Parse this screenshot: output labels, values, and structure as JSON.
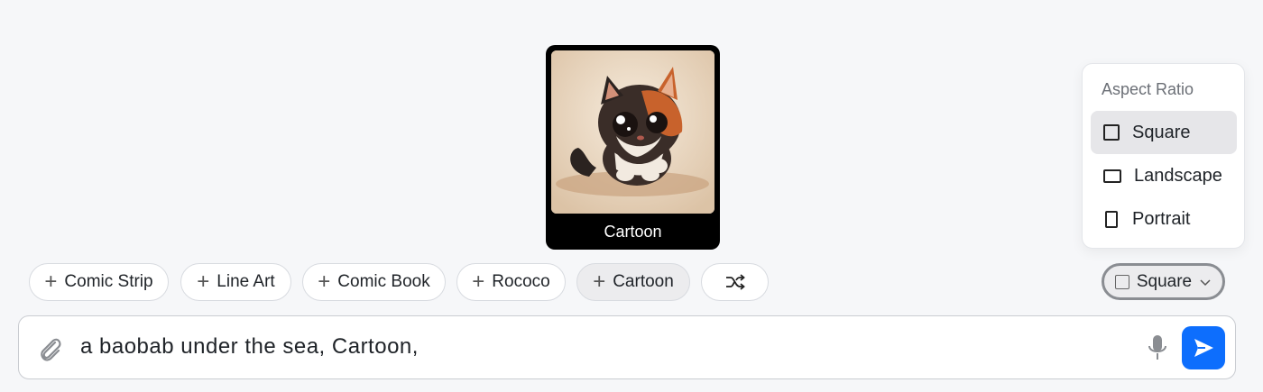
{
  "preview": {
    "label": "Cartoon",
    "image_icon": "cartoon-kitten-image"
  },
  "chips": [
    {
      "label": "Comic Strip",
      "icon": "plus-icon"
    },
    {
      "label": "Line Art",
      "icon": "plus-icon"
    },
    {
      "label": "Comic Book",
      "icon": "plus-icon"
    },
    {
      "label": "Rococo",
      "icon": "plus-icon"
    },
    {
      "label": "Cartoon",
      "icon": "plus-icon",
      "active": true
    },
    {
      "label": "",
      "icon": "shuffle-icon"
    }
  ],
  "aspect_menu": {
    "heading": "Aspect Ratio",
    "options": [
      {
        "label": "Square",
        "icon": "square-icon",
        "selected": true
      },
      {
        "label": "Landscape",
        "icon": "landscape-icon"
      },
      {
        "label": "Portrait",
        "icon": "portrait-icon"
      }
    ]
  },
  "aspect_button": {
    "label": "Square",
    "icon": "square-icon",
    "chevron": "chevron-down-icon"
  },
  "prompt": {
    "value": "a baobab under the sea, Cartoon,",
    "attach_icon": "paperclip-icon",
    "mic_icon": "microphone-icon",
    "send_icon": "send-icon"
  },
  "colors": {
    "accent": "#0d6efd",
    "background": "#f6f7f9",
    "selected": "#e6e6e9"
  }
}
